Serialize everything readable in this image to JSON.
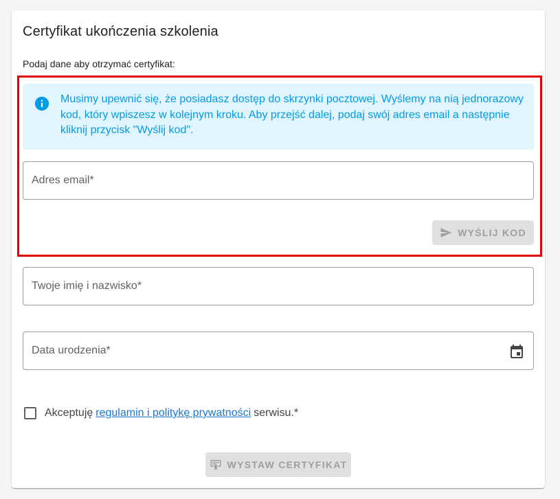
{
  "card": {
    "title": "Certyfikat ukończenia szkolenia",
    "subtitle": "Podaj dane aby otrzymać certyfikat:"
  },
  "alert": {
    "icon": "info-icon",
    "text": "Musimy upewnić się, że posiadasz dostęp do skrzynki pocztowej. Wyślemy na nią jednorazowy kod, który wpiszesz w kolejnym kroku. Aby przejść dalej, podaj swój adres email a następnie kliknij przycisk \"Wyślij kod\".",
    "color": "#039be5",
    "background": "#e1f5fe"
  },
  "email_field": {
    "placeholder": "Adres email*",
    "value": ""
  },
  "send_button": {
    "label": "Wyślij kod",
    "icon": "send-icon"
  },
  "name_field": {
    "placeholder": "Twoje imię i nazwisko*",
    "value": ""
  },
  "birthdate_field": {
    "placeholder": "Data urodzenia*",
    "value": "",
    "icon": "calendar-icon"
  },
  "terms": {
    "prefix": "Akceptuję",
    "link": "regulamin i politykę prywatności",
    "suffix": "serwisu.*",
    "checked": false
  },
  "certificate_button": {
    "label": "Wystaw certyfikat",
    "icon": "certificate-icon"
  },
  "highlight_color": "#e00000"
}
